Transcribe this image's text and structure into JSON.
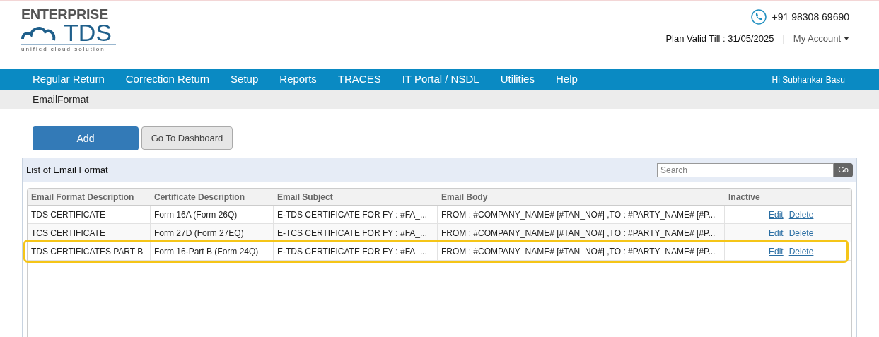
{
  "logo": {
    "top": "ENTERPRISE",
    "main": "TDS",
    "tagline": "unified cloud solution"
  },
  "header": {
    "phone": "+91 98308 69690",
    "plan": "Plan Valid Till : 31/05/2025",
    "separator": "|",
    "account": "My Account"
  },
  "nav": {
    "items": [
      "Regular Return",
      "Correction Return",
      "Setup",
      "Reports",
      "TRACES",
      "IT Portal / NSDL",
      "Utilities",
      "Help"
    ],
    "greeting": "Hi Subhankar Basu"
  },
  "breadcrumb": "EmailFormat",
  "buttons": [
    {
      "label": "Add",
      "kind": "primary"
    },
    {
      "label": "Go To Dashboard",
      "kind": "secondary"
    }
  ],
  "panel": {
    "title": "List of Email Format",
    "search": {
      "placeholder": "Search",
      "button": "Go"
    }
  },
  "table": {
    "columns": [
      "Email Format Description",
      "Certificate Description",
      "Email Subject",
      "Email Body",
      "Inactive"
    ],
    "rows": [
      {
        "cells": [
          "TDS CERTIFICATE",
          "Form 16A (Form 26Q)",
          "E-TDS CERTIFICATE FOR FY : #FA_...",
          "FROM : #COMPANY_NAME# [#TAN_NO#] ,TO : #PARTY_NAME# [#P...",
          ""
        ],
        "actions": [
          "Edit",
          "Delete"
        ],
        "highlighted": false
      },
      {
        "cells": [
          "TCS CERTIFICATE",
          "Form 27D (Form 27EQ)",
          "E-TCS CERTIFICATE FOR FY : #FA_...",
          "FROM : #COMPANY_NAME# [#TAN_NO#] ,TO : #PARTY_NAME# [#P...",
          ""
        ],
        "actions": [
          "Edit",
          "Delete"
        ],
        "highlighted": false
      },
      {
        "cells": [
          "TDS CERTIFICATES PART B",
          "Form 16-Part B (Form 24Q)",
          "E-TDS CERTIFICATE FOR FY : #FA_...",
          "FROM : #COMPANY_NAME# [#TAN_NO#] ,TO : #PARTY_NAME# [#P...",
          ""
        ],
        "actions": [
          "Edit",
          "Delete"
        ],
        "highlighted": true
      }
    ]
  }
}
